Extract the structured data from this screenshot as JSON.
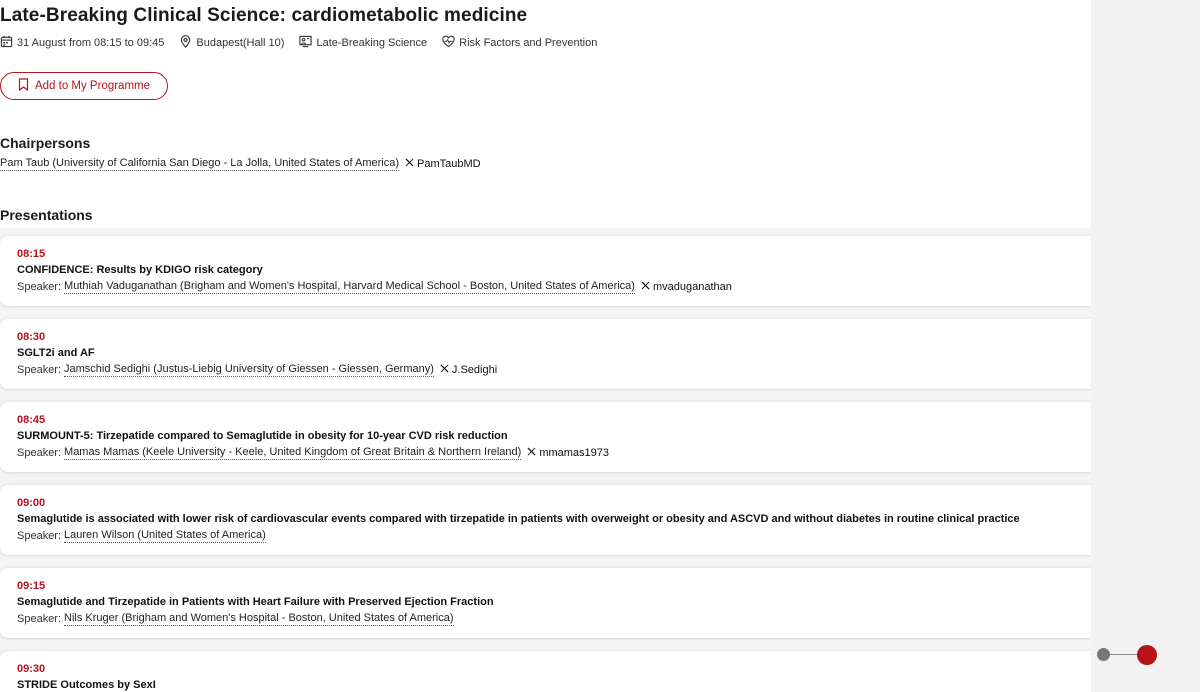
{
  "session": {
    "title": "Late-Breaking Clinical Science: cardiometabolic medicine",
    "date": "31 August from 08:15 to 09:45",
    "location": "Budapest(Hall 10)",
    "type": "Late-Breaking Science",
    "topic": "Risk Factors and Prevention",
    "add_button_label": "Add to My Programme"
  },
  "chairpersons": {
    "heading": "Chairpersons",
    "items": [
      {
        "name": "Pam Taub (University of California San Diego - La Jolla, United States of America)",
        "x_handle": "PamTaubMD"
      }
    ]
  },
  "presentations": {
    "heading": "Presentations",
    "speaker_label": "Speaker:",
    "items": [
      {
        "time": "08:15",
        "title": "CONFIDENCE: Results by KDIGO risk category",
        "speaker": "Muthiah Vaduganathan (Brigham and Women's Hospital, Harvard Medical School - Boston, United States of America)",
        "x_handle": "mvaduganathan"
      },
      {
        "time": "08:30",
        "title": "SGLT2i and AF",
        "speaker": "Jamschid Sedighi (Justus-Liebig University of Giessen - Giessen, Germany)",
        "x_handle": "J.Sedighi"
      },
      {
        "time": "08:45",
        "title": "SURMOUNT-5: Tirzepatide compared to Semaglutide in obesity for 10-year CVD risk reduction",
        "speaker": "Mamas Mamas (Keele University - Keele, United Kingdom of Great Britain & Northern Ireland)",
        "x_handle": "mmamas1973"
      },
      {
        "time": "09:00",
        "title": "Semaglutide is associated with lower risk of cardiovascular events compared with tirzepatide in patients with overweight or obesity and ASCVD and without diabetes in routine clinical practice",
        "speaker": "Lauren Wilson (United States of America)",
        "x_handle": ""
      },
      {
        "time": "09:15",
        "title": "Semaglutide and Tirzepatide in Patients with Heart Failure with Preserved Ejection Fraction",
        "speaker": "Nils Kruger (Brigham and Women's Hospital - Boston, United States of America)",
        "x_handle": ""
      },
      {
        "time": "09:30",
        "title": "STRIDE Outcomes by SexI",
        "speaker": "",
        "x_handle": ""
      }
    ]
  },
  "colors": {
    "accent": "#b5121b",
    "text": "#1a1a1a",
    "rail_bg": "#f2f2f2",
    "section_bg": "#f4f4f4"
  },
  "icons": {
    "date": "calendar-icon",
    "location": "location-pin-icon",
    "type": "presenter-board-icon",
    "topic": "heart-pulse-icon",
    "add": "bookmark-icon",
    "social": "x-logo-icon"
  }
}
